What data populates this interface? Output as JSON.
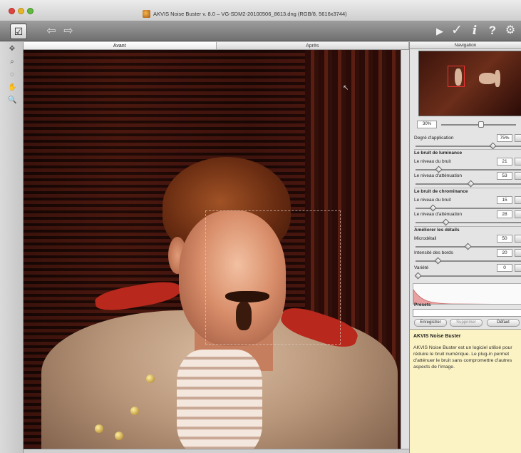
{
  "window": {
    "title": "AKVIS Noise Buster v. 8.0 – VG-SDM2-20100506_8613.dng (RGB/8, 5616x3744)"
  },
  "icons": {
    "app_logo": "akvis-logo-icon",
    "menu": "app-menu-icon",
    "undo": "arrow-left-icon",
    "redo": "arrow-right-icon",
    "run": "play-icon",
    "apply": "checkmark-icon",
    "info": "info-icon",
    "help": "question-icon",
    "settings": "settings-icon"
  },
  "toolbar": {
    "menu_glyph": "☑",
    "undo_glyph": "⇦",
    "redo_glyph": "⇨",
    "run_glyph": "▶",
    "apply_glyph": "✓",
    "info_glyph": "i",
    "help_glyph": "?",
    "settings_glyph": "⚙"
  },
  "tools": [
    {
      "name": "hand-tool-icon",
      "glyph": "✥"
    },
    {
      "name": "zoom-tool-icon",
      "glyph": "⌕"
    },
    {
      "name": "preview-tool-icon",
      "glyph": "◌"
    },
    {
      "name": "pan-tool-icon",
      "glyph": "✋"
    },
    {
      "name": "magnifier-icon",
      "glyph": "🔍"
    }
  ],
  "tabs": {
    "before": "Avant",
    "after": "Après"
  },
  "navigation": {
    "header": "Navigation",
    "zoom": "30%"
  },
  "params": {
    "application_degree": {
      "label": "Degré d'application",
      "value": "75%",
      "level": 0.75
    },
    "luminance_section": "Le bruit de luminance",
    "lum_noise_level": {
      "label": "Le niveau du bruit",
      "value": "21",
      "level": 0.21
    },
    "lum_attenuation": {
      "label": "Le niveau d'atténuation",
      "value": "53",
      "level": 0.53
    },
    "chroma_section": "Le bruit de chrominance",
    "chroma_noise_level": {
      "label": "Le niveau du bruit",
      "value": "15",
      "level": 0.15
    },
    "chroma_attenuation": {
      "label": "Le niveau d'atténuation",
      "value": "28",
      "level": 0.28
    },
    "details_section": "Améliorer les détails",
    "microdetail": {
      "label": "Microdétail",
      "value": "50",
      "level": 0.5
    },
    "edge_intensity": {
      "label": "Intensité des bords",
      "value": "20",
      "level": 0.2
    },
    "grain": {
      "label": "Variété",
      "value": "0",
      "level": 0.0
    }
  },
  "presets": {
    "label": "Presets",
    "save": "Enregistrer",
    "delete": "Supprimer",
    "default": "Défaut"
  },
  "info": {
    "title": "AKVIS Noise Buster",
    "text": "AKVIS Noise Buster est un logiciel utilisé pour réduire le bruit numérique. Le plug-in permet d'atténuer le bruit sans compromettre d'autres aspects de l'image."
  }
}
